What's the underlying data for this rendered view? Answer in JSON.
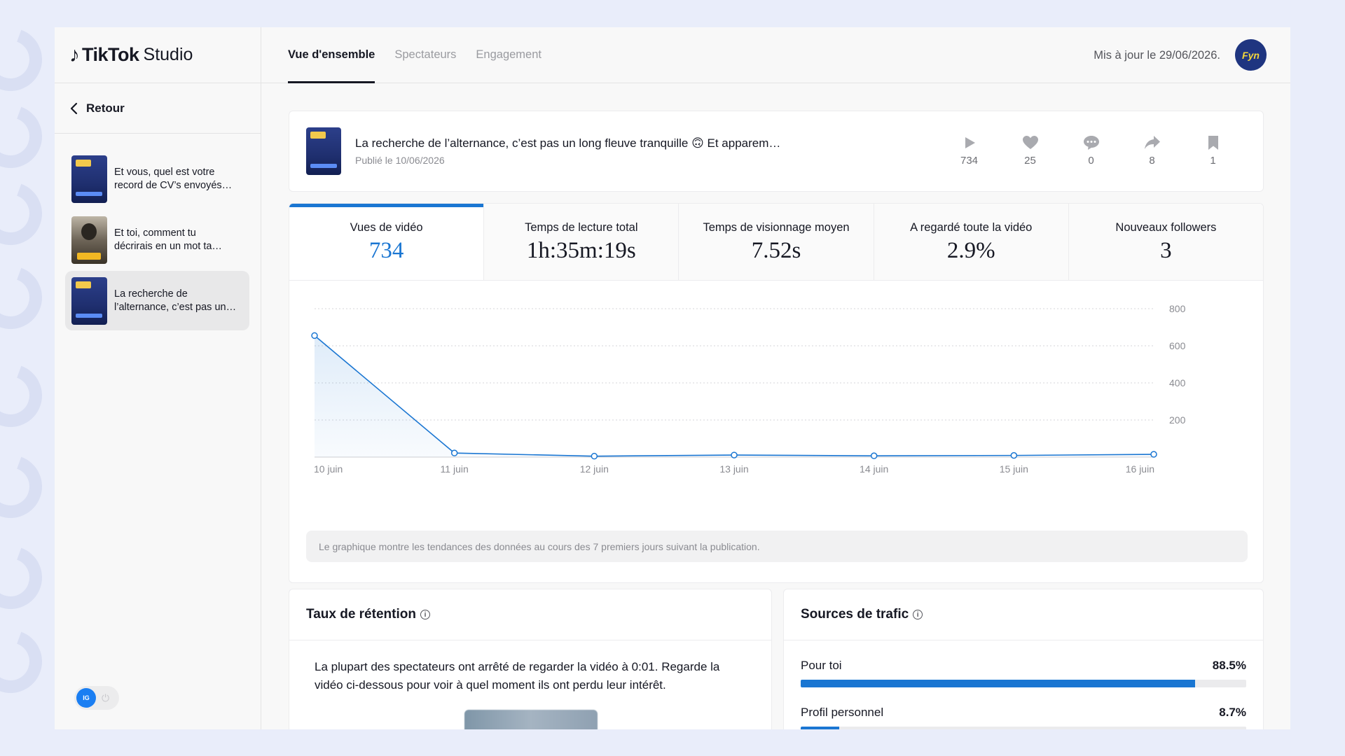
{
  "app": {
    "brand": "TikTok",
    "product": "Studio"
  },
  "sidebar": {
    "back_label": "Retour",
    "videos": [
      {
        "title_line1": "Et vous, quel est votre",
        "title_line2": "record de CV’s envoyés…",
        "active": false
      },
      {
        "title_line1": "Et toi, comment tu",
        "title_line2": "décrirais en un mot ta…",
        "active": false
      },
      {
        "title_line1": "La recherche de",
        "title_line2": "l’alternance, c’est pas un…",
        "active": true
      }
    ],
    "toggle_badge": "IG"
  },
  "header": {
    "tabs": [
      {
        "label": "Vue d'ensemble",
        "active": true
      },
      {
        "label": "Spectateurs",
        "active": false
      },
      {
        "label": "Engagement",
        "active": false
      }
    ],
    "updated": "Mis à jour le 29/06/2026.",
    "avatar_text": "Fyn"
  },
  "video": {
    "title": "La recherche de l’alternance, c’est pas un long fleuve tranquille 🙃 Et apparem…",
    "published": "Publié le 10/06/2026",
    "stats": {
      "plays": "734",
      "likes": "25",
      "comments": "0",
      "shares": "8",
      "saves": "1"
    }
  },
  "metrics": [
    {
      "label": "Vues de vidéo",
      "value": "734",
      "active": true
    },
    {
      "label": "Temps de lecture total",
      "value": "1h:35m:19s",
      "active": false
    },
    {
      "label": "Temps de visionnage moyen",
      "value": "7.52s",
      "active": false
    },
    {
      "label": "A regardé toute la vidéo",
      "value": "2.9%",
      "active": false
    },
    {
      "label": "Nouveaux followers",
      "value": "3",
      "active": false
    }
  ],
  "chart_data": {
    "type": "area",
    "categories": [
      "10 juin",
      "11 juin",
      "12 juin",
      "13 juin",
      "14 juin",
      "15 juin",
      "16 juin"
    ],
    "series": [
      {
        "values": [
          655,
          22,
          5,
          11,
          7,
          9,
          15
        ]
      }
    ],
    "ylim": [
      0,
      800
    ],
    "yticks": [
      200,
      400,
      600,
      800
    ],
    "y_axis_position": "right",
    "grid": true,
    "color": "#1a76d2"
  },
  "chart_note": "Le graphique montre les tendances des données au cours des 7 premiers jours suivant la publication.",
  "retention": {
    "title": "Taux de rétention",
    "text": "La plupart des spectateurs ont arrêté de regarder la vidéo à 0:01. Regarde la vidéo ci-dessous pour voir à quel moment ils ont perdu leur intérêt."
  },
  "traffic": {
    "title": "Sources de trafic",
    "sources": [
      {
        "label": "Pour toi",
        "value": "88.5%",
        "fraction": 0.885
      },
      {
        "label": "Profil personnel",
        "value": "8.7%",
        "fraction": 0.087
      }
    ]
  },
  "colors": {
    "accent": "#1a76d2",
    "avatar_bg": "#1f3580",
    "page_bg": "#e9edfa"
  }
}
